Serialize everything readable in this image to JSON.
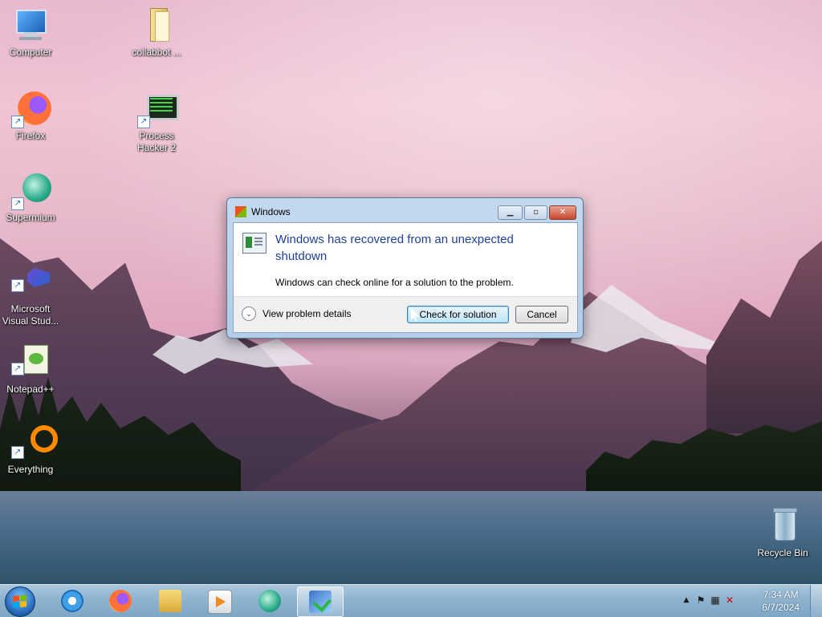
{
  "desktop": {
    "icons": [
      {
        "label": "Computer"
      },
      {
        "label": "collabbot ..."
      },
      {
        "label": "Firefox"
      },
      {
        "label": "Process Hacker 2"
      },
      {
        "label": "Supermium"
      },
      {
        "label": "Microsoft Visual Stud..."
      },
      {
        "label": "Notepad++"
      },
      {
        "label": "Everything"
      },
      {
        "label": "Recycle Bin"
      }
    ]
  },
  "dialog": {
    "title": "Windows",
    "heading": "Windows has recovered from an unexpected shutdown",
    "message": "Windows can check online for a solution to the problem.",
    "details_label": "View problem details",
    "check_button": "Check for solution",
    "cancel_button": "Cancel"
  },
  "taskbar": {
    "apps": [
      {
        "icon": "internet-explorer-icon"
      },
      {
        "icon": "firefox-icon"
      },
      {
        "icon": "file-explorer-icon"
      },
      {
        "icon": "media-player-icon"
      },
      {
        "icon": "supermium-icon"
      },
      {
        "icon": "problem-reports-icon",
        "active": true
      }
    ],
    "clock": {
      "time": "7:34 AM",
      "date": "6/7/2024"
    },
    "tray_up_arrow": "▲"
  },
  "colors": {
    "dialog_heading": "#1f3f99",
    "taskbar": "#8fb3cf"
  }
}
